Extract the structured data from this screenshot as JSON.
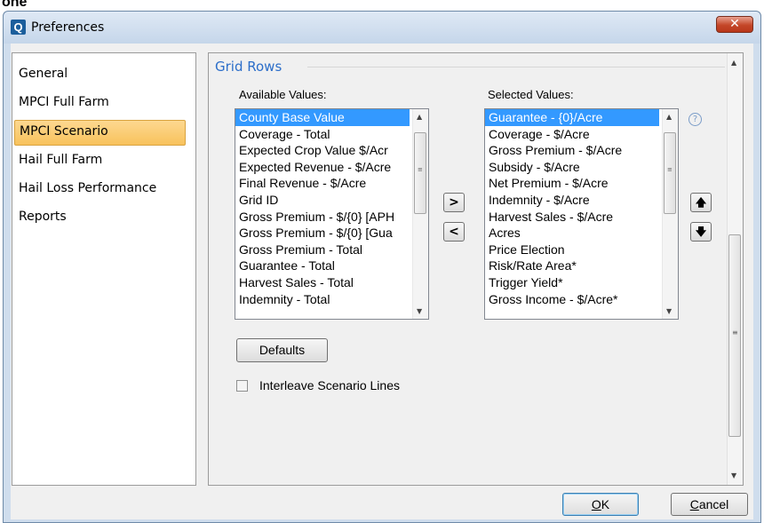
{
  "window": {
    "title": "Preferences",
    "app_icon": "Q"
  },
  "background_text": "one",
  "nav": {
    "items": [
      {
        "label": "General",
        "selected": false
      },
      {
        "label": "MPCI Full Farm",
        "selected": false
      },
      {
        "label": "MPCI Scenario",
        "selected": true
      },
      {
        "label": "Hail Full Farm",
        "selected": false
      },
      {
        "label": "Hail Loss Performance",
        "selected": false
      },
      {
        "label": "Reports",
        "selected": false
      }
    ]
  },
  "section": {
    "title": "Grid Rows",
    "available_label": "Available Values:",
    "selected_label": "Selected Values:",
    "available_values": [
      "County Base Value",
      "Coverage - Total",
      "Expected Crop Value $/Acr",
      "Expected Revenue - $/Acre",
      "Final Revenue - $/Acre",
      "Grid ID",
      "Gross Premium - $/{0} [APH",
      "Gross Premium - $/{0} [Gua",
      "Gross Premium - Total",
      "Guarantee - Total",
      "Harvest Sales - Total",
      "Indemnity - Total"
    ],
    "selected_values": [
      "Guarantee - {0}/Acre",
      "Coverage - $/Acre",
      "Gross Premium - $/Acre",
      "Subsidy - $/Acre",
      "Net Premium - $/Acre",
      "Indemnity - $/Acre",
      "Harvest Sales - $/Acre",
      "Acres",
      "Price Election",
      "Risk/Rate Area*",
      "Trigger Yield*",
      "Gross Income - $/Acre*"
    ],
    "move_right": ">",
    "move_left": "<",
    "move_up": "🡅",
    "move_down": "🡇",
    "help": "?",
    "defaults_button": "Defaults",
    "interleave_label": "Interleave Scenario Lines",
    "interleave_checked": false
  },
  "footer": {
    "ok_underline": "O",
    "ok_rest": "K",
    "cancel_underline": "C",
    "cancel_rest": "ancel"
  }
}
